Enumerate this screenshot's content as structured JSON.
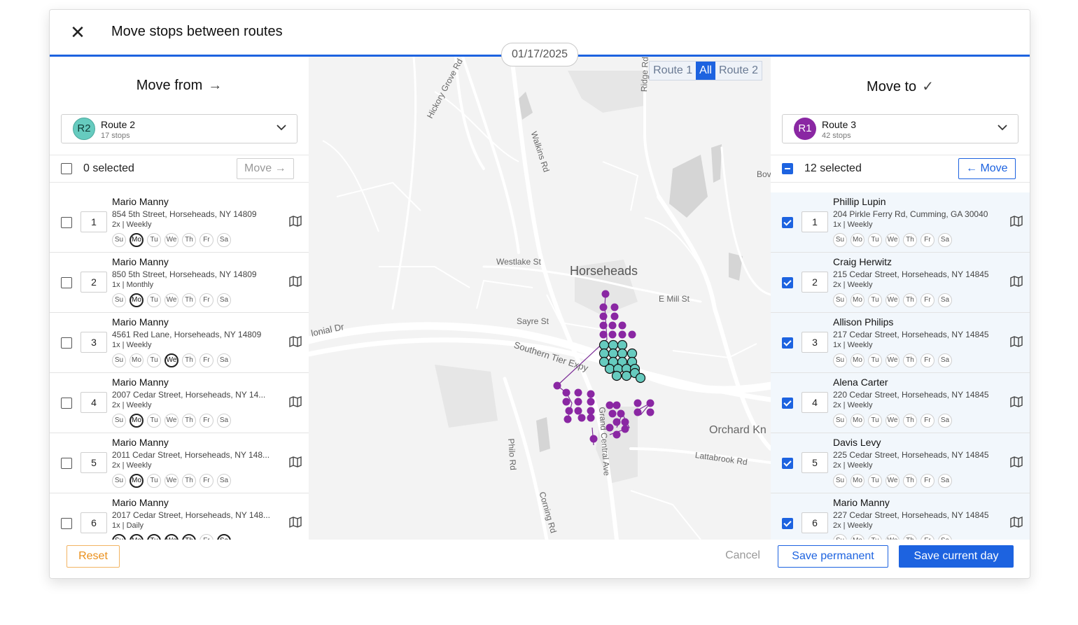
{
  "dialog": {
    "title": "Move stops between routes",
    "date": "01/17/2025"
  },
  "left": {
    "title": "Move from",
    "route": {
      "badge": "R2",
      "name": "Route 2",
      "stops": "17 stops"
    },
    "selected_text": "0 selected",
    "move_label": "Move",
    "stops": [
      {
        "num": "1",
        "name": "Mario Manny",
        "address": "854 5th Street, Horseheads, NY 14809",
        "freq": "2x | Weekly"
      },
      {
        "num": "2",
        "name": "Mario Manny",
        "address": "850 5th Street, Horseheads, NY 14809",
        "freq": "1x | Monthly"
      },
      {
        "num": "3",
        "name": "Mario Manny",
        "address": "4561 Red Lane, Horseheads, NY 14809",
        "freq": "1x | Weekly"
      },
      {
        "num": "4",
        "name": "Mario Manny",
        "address": "2007 Cedar Street, Horseheads, NY 14...",
        "freq": "2x | Weekly"
      },
      {
        "num": "5",
        "name": "Mario Manny",
        "address": "2011 Cedar Street, Horseheads, NY 148...",
        "freq": "2x | Weekly"
      },
      {
        "num": "6",
        "name": "Mario Manny",
        "address": "2017 Cedar Street, Horseheads, NY 148...",
        "freq": "1x | Daily"
      }
    ]
  },
  "right": {
    "title": "Move to",
    "route": {
      "badge": "R1",
      "name": "Route 3",
      "stops": "42 stops"
    },
    "selected_text": "12 selected",
    "move_label": "Move",
    "stops": [
      {
        "num": "1",
        "name": "Phillip Lupin",
        "address": "204 Pirkle Ferry Rd, Cumming, GA 30040",
        "freq": "1x | Weekly"
      },
      {
        "num": "2",
        "name": "Craig Herwitz",
        "address": "215 Cedar Street, Horseheads, NY 14845",
        "freq": "2x | Weekly"
      },
      {
        "num": "3",
        "name": "Allison Philips",
        "address": "217 Cedar Street, Horseheads, NY 14845",
        "freq": "1x | Weekly"
      },
      {
        "num": "4",
        "name": "Alena Carter",
        "address": "220 Cedar Street, Horseheads, NY 14845",
        "freq": "2x | Weekly"
      },
      {
        "num": "5",
        "name": "Davis Levy",
        "address": "225 Cedar Street, Horseheads, NY 14845",
        "freq": "2x | Weekly"
      },
      {
        "num": "6",
        "name": "Mario Manny",
        "address": "227 Cedar Street, Horseheads, NY 14845",
        "freq": "2x | Weekly"
      }
    ]
  },
  "days": [
    "Su",
    "Mo",
    "Tu",
    "We",
    "Th",
    "Fr",
    "Sa"
  ],
  "map": {
    "filters": [
      "Route 1",
      "All",
      "Route 2"
    ],
    "active_filter": "All",
    "labels": [
      "Horseheads",
      "Westlake St",
      "E Mill St",
      "Sayre St",
      "Southern Tier Expy",
      "lonial Dr",
      "Hickory Grove Rd",
      "Walkins Rd",
      "Ridge Rd",
      "Orchard Kn",
      "Lattabrook Rd",
      "Grand Central Ave",
      "Philo Rd",
      "Corning Rd",
      "Bov"
    ]
  },
  "footer": {
    "reset": "Reset",
    "cancel": "Cancel",
    "save_permanent": "Save permanent",
    "save_current_day": "Save current day"
  },
  "colors": {
    "accent": "#1d63e0",
    "route2": "#66cbbf",
    "route3": "#8a27a3",
    "reset": "#ea8f1b"
  }
}
